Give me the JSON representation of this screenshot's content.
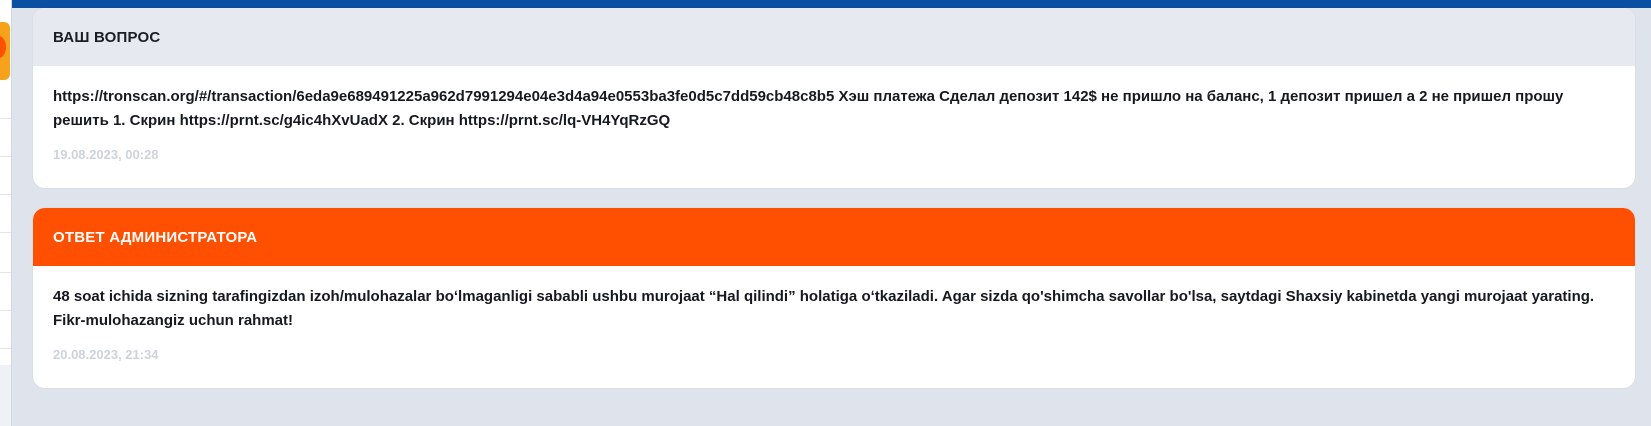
{
  "question": {
    "header": "ВАШ ВОПРОС",
    "text": "https://tronscan.org/#/transaction/6eda9e689491225a962d7991294e04e3d4a94e0553ba3fe0d5c7dd59cb48c8b5 Хэш платежа Сделал депозит 142$ не пришло на баланс, 1 депозит пришел а 2 не пришел прошу решить 1. Скрин https://prnt.sc/g4ic4hXvUadX 2. Скрин https://prnt.sc/lq-VH4YqRzGQ",
    "date": "19.08.2023, 00:28"
  },
  "answer": {
    "header": "ОТВЕТ АДМИНИСТРАТОРА",
    "text": "48 soat ichida sizning tarafingizdan izoh/mulohazalar boʻlmaganligi sababli ushbu murojaat “Hal qilindi” holatiga oʻtkaziladi. Agar sizda qo'shimcha savollar bo'lsa, saytdagi Shaxsiy kabinetda yangi murojaat yarating. Fikr-mulohazangiz uchun rahmat!",
    "date": "20.08.2023, 21:34"
  },
  "colors": {
    "top_band": "#0b4fa3",
    "answer_header": "#ff4f00",
    "page_background": "#dfe4ec"
  }
}
